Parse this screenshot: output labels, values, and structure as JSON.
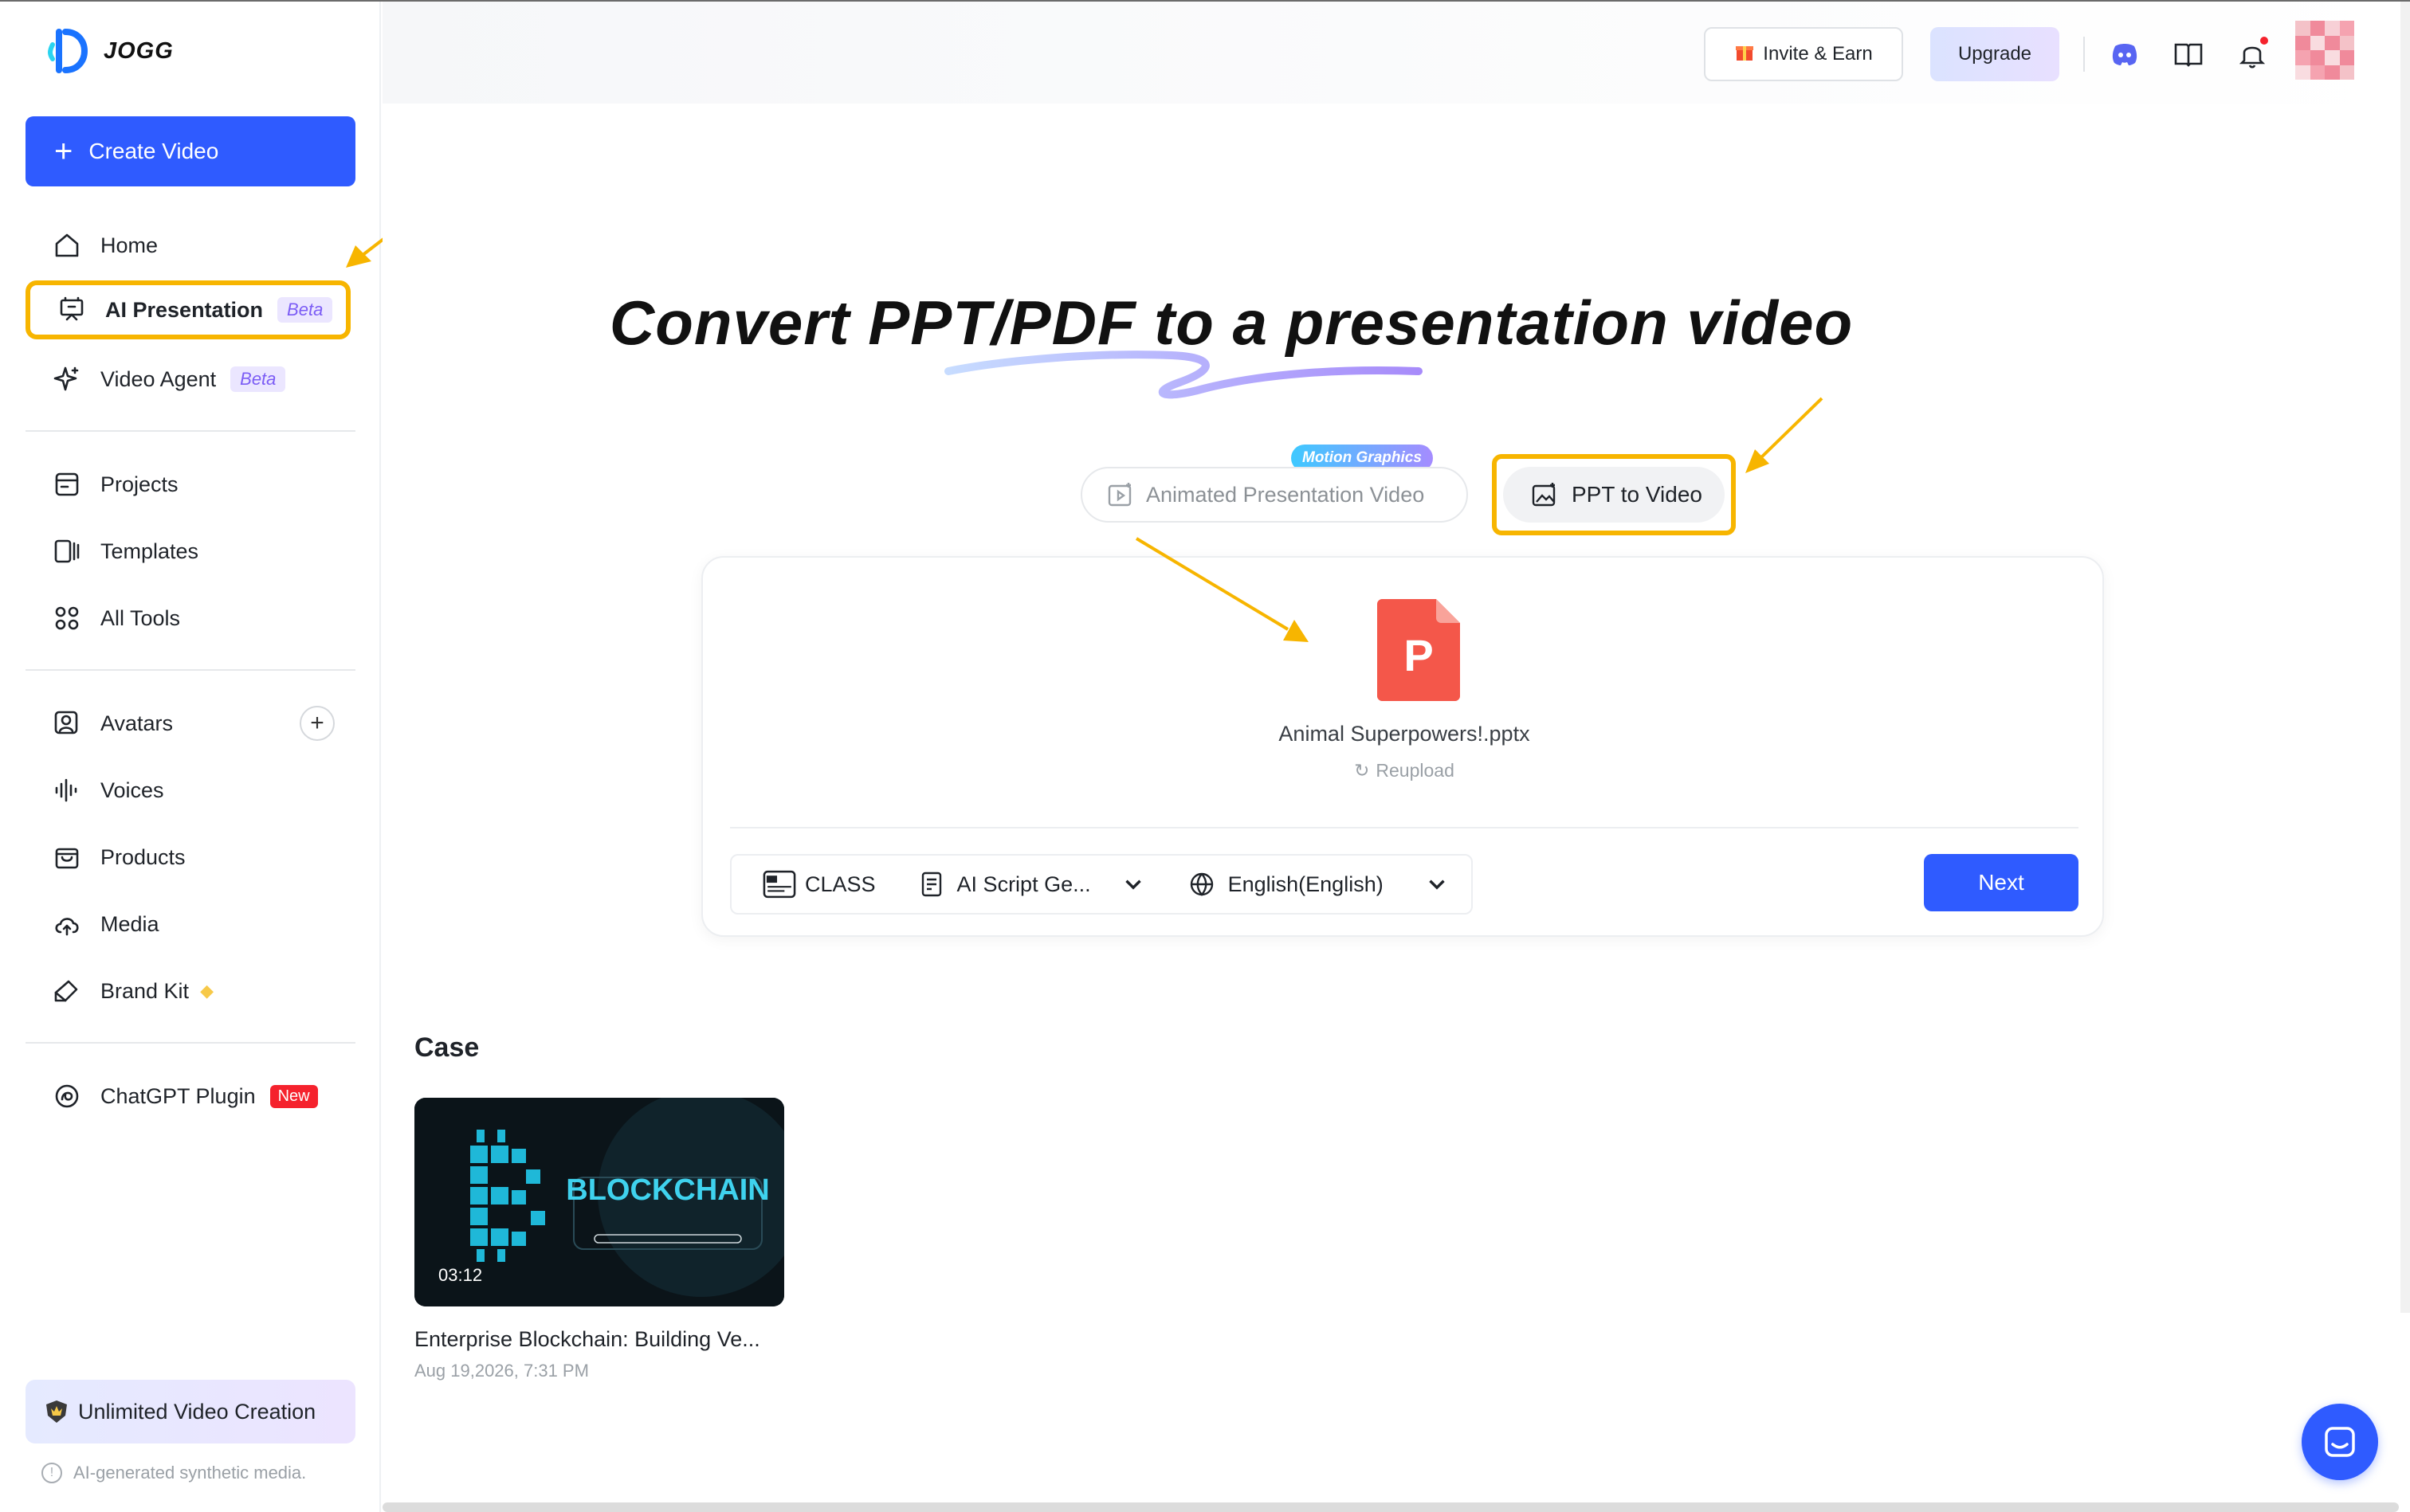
{
  "brand": {
    "name": "JOGG"
  },
  "sidebar": {
    "create_label": "Create Video",
    "items": [
      {
        "label": "Home",
        "icon": "home-icon"
      },
      {
        "label": "AI Presentation",
        "badge": "Beta",
        "icon": "presentation-icon"
      },
      {
        "label": "Video Agent",
        "badge": "Beta",
        "icon": "sparkle-icon"
      },
      {
        "label": "Projects",
        "icon": "folder-icon"
      },
      {
        "label": "Templates",
        "icon": "templates-icon"
      },
      {
        "label": "All Tools",
        "icon": "grid-icon"
      },
      {
        "label": "Avatars",
        "icon": "avatar-icon"
      },
      {
        "label": "Voices",
        "icon": "voice-wave-icon"
      },
      {
        "label": "Products",
        "icon": "bag-icon"
      },
      {
        "label": "Media",
        "icon": "cloud-upload-icon"
      },
      {
        "label": "Brand Kit",
        "icon": "brand-kit-icon"
      },
      {
        "label": "ChatGPT Plugin",
        "badge": "New",
        "icon": "chatgpt-icon"
      }
    ],
    "unlimited_label": "Unlimited Video Creation",
    "ai_note": "AI-generated synthetic media."
  },
  "topbar": {
    "invite_label": "Invite & Earn",
    "upgrade_label": "Upgrade",
    "icons": [
      "discord-icon",
      "book-icon",
      "bell-icon",
      "user-avatar"
    ]
  },
  "hero": {
    "title": "Convert PPT/PDF to a presentation video"
  },
  "modes": {
    "tab1_label": "Animated Presentation Video",
    "tab1_tag": "Motion Graphics",
    "tab2_label": "PPT to Video"
  },
  "upload": {
    "file_name": "Animal Superpowers!.pptx",
    "reupload_label": "Reupload",
    "template_label": "CLASS",
    "script_label": "AI Script Ge...",
    "language_label": "English(English)",
    "next_label": "Next"
  },
  "case": {
    "title": "Case",
    "items": [
      {
        "thumb_text": "BLOCKCHAIN",
        "duration": "03:12",
        "name": "Enterprise Blockchain: Building Ve...",
        "date": "Aug 19,2026, 7:31 PM"
      }
    ]
  },
  "colors": {
    "primary": "#2f5bff",
    "highlight": "#f7b500",
    "beta_bg": "#ebe6ff",
    "beta_text": "#7b5cf5",
    "new_badge": "#f5222d",
    "ppt_red": "#f4574a"
  }
}
